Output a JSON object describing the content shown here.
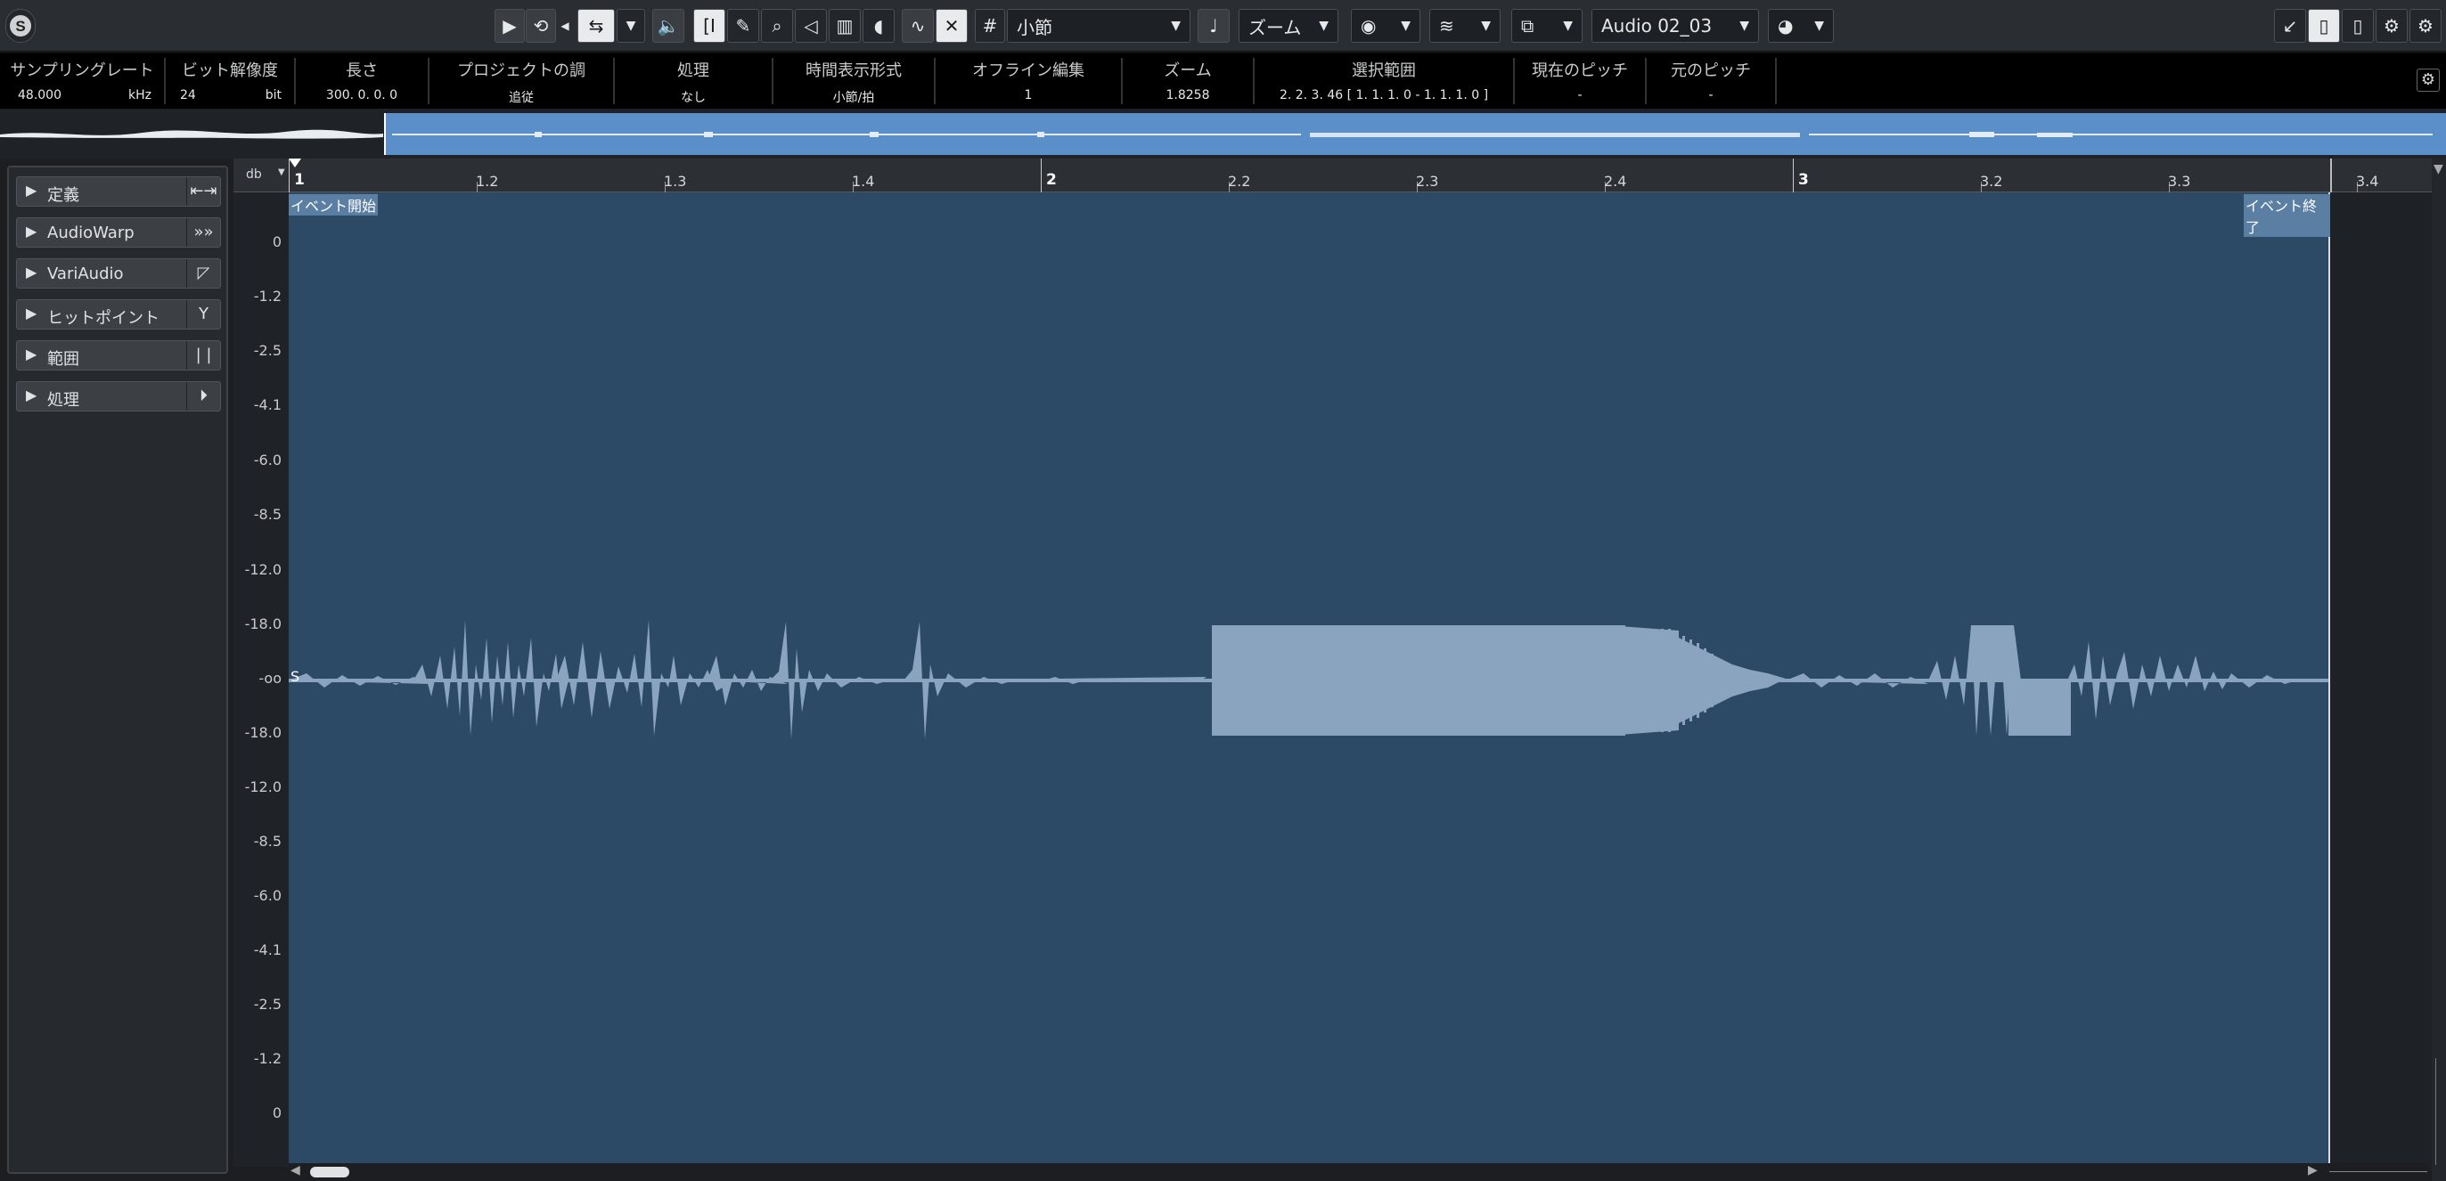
{
  "toolbar": {
    "app_icon": "cubase-logo-icon",
    "snap_type": "小節",
    "zoom_label": "ズーム",
    "audio_name": "Audio 02_03"
  },
  "infoline": {
    "items": [
      {
        "label": "サンプリングレート",
        "value": "48.000",
        "unit": "kHz"
      },
      {
        "label": "ビット解像度",
        "value": "24",
        "unit": "bit"
      },
      {
        "label": "長さ",
        "value": "300. 0. 0.  0"
      },
      {
        "label": "プロジェクトの調",
        "value": "追従"
      },
      {
        "label": "処理",
        "value": "なし"
      },
      {
        "label": "時間表示形式",
        "value": "小節/拍"
      },
      {
        "label": "オフライン編集",
        "value": "1"
      },
      {
        "label": "ズーム",
        "value": "1.8258"
      },
      {
        "label": "選択範囲",
        "value": "2. 2. 3. 46 [ 1. 1. 1.  0 - 1. 1. 1.  0 ]"
      },
      {
        "label": "現在のピッチ",
        "value": "-"
      },
      {
        "label": "元のピッチ",
        "value": "-"
      }
    ]
  },
  "ruler": {
    "unit_label": "db",
    "marks": [
      "1",
      "1.2",
      "1.3",
      "1.4",
      "2",
      "2.2",
      "2.3",
      "2.4",
      "3",
      "3.2",
      "3.3",
      "3.4"
    ]
  },
  "left_panel": {
    "sections": [
      {
        "label": "定義",
        "icon": "definition-icon"
      },
      {
        "label": "AudioWarp",
        "icon": "audiowarp-icon"
      },
      {
        "label": "VariAudio",
        "icon": "variaudio-icon"
      },
      {
        "label": "ヒットポイント",
        "icon": "hitpoint-icon"
      },
      {
        "label": "範囲",
        "icon": "range-icon"
      },
      {
        "label": "処理",
        "icon": "process-icon"
      }
    ]
  },
  "db_scale": [
    "0",
    "-1.2",
    "-2.5",
    "-4.1",
    "-6.0",
    "-8.5",
    "-12.0",
    "-18.0",
    "-oo",
    "-18.0",
    "-12.0",
    "-8.5",
    "-6.0",
    "-4.1",
    "-2.5",
    "-1.2",
    "0"
  ],
  "editor": {
    "event_start": "イベント開始",
    "event_end": "イベント終了",
    "sustain_marker": "S"
  },
  "colors": {
    "editor_bg": "#2c4a66",
    "waveform": "#8aa3bf",
    "overview": "#5b8fc9"
  }
}
